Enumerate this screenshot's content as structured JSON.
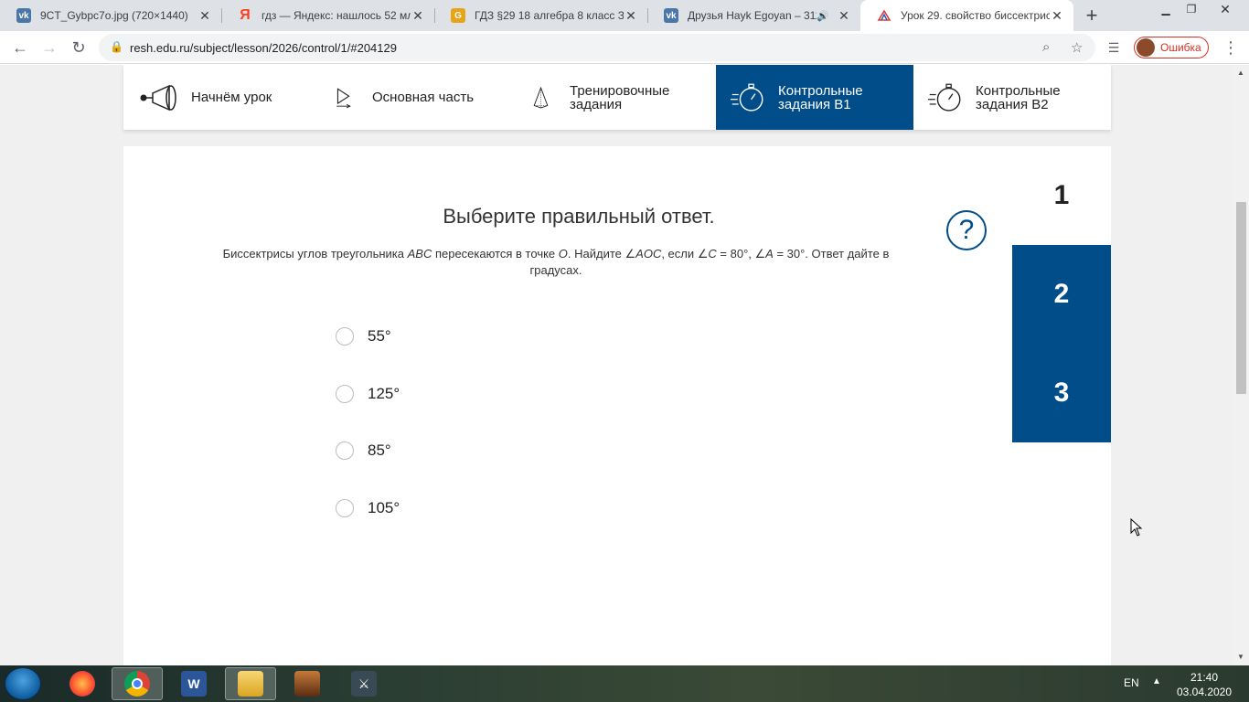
{
  "browser": {
    "tabs": [
      {
        "title": "9CT_Gybpc7o.jpg (720×1440)",
        "favicon": "vk-icon",
        "color": "#4a76a8"
      },
      {
        "title": "гдз — Яндекс: нашлось 52 млн",
        "favicon": "yandex-icon",
        "color": "#fc3f1d"
      },
      {
        "title": "ГДЗ §29 18 алгебра 8 класс Зад",
        "favicon": "gdz-icon",
        "color": "#e8a317"
      },
      {
        "title": "Друзья Hayk Egoyan – 311",
        "favicon": "vk-icon",
        "color": "#4a76a8"
      },
      {
        "title": "Урок 29. свойство биссектрис",
        "favicon": "resh-icon",
        "color": "#004d8a"
      }
    ],
    "url": "resh.edu.ru/subject/lesson/2026/control/1/#204129",
    "profile_label": "Ошибка"
  },
  "lesson_nav": {
    "steps": [
      {
        "label": "Начнём урок",
        "icon": "megaphone-icon"
      },
      {
        "label": "Основная часть",
        "icon": "play-icon"
      },
      {
        "label": "Тренировочные задания",
        "icon": "pyramid-icon"
      },
      {
        "label": "Контрольные задания В1",
        "icon": "stopwatch-icon"
      },
      {
        "label": "Контрольные задания В2",
        "icon": "stopwatch-icon"
      }
    ]
  },
  "question": {
    "heading": "Выберите правильный ответ.",
    "text_parts": [
      "Биссектрисы углов треугольника ",
      "ABC",
      " пересекаются в точке ",
      "O",
      ". Найдите ∠",
      "AOC",
      ", если ∠",
      "C",
      " = 80°, ∠",
      "A",
      " = 30°. Ответ дайте в градусах."
    ],
    "help_symbol": "?",
    "options": [
      "55°",
      "125°",
      "85°",
      "105°"
    ]
  },
  "question_numbers": [
    {
      "label": "1",
      "state": "current"
    },
    {
      "label": "2",
      "state": "done"
    },
    {
      "label": "3",
      "state": "done"
    }
  ],
  "taskbar": {
    "language": "EN",
    "time": "21:40",
    "date": "03.04.2020"
  },
  "colors": {
    "accent": "#004d8a"
  }
}
